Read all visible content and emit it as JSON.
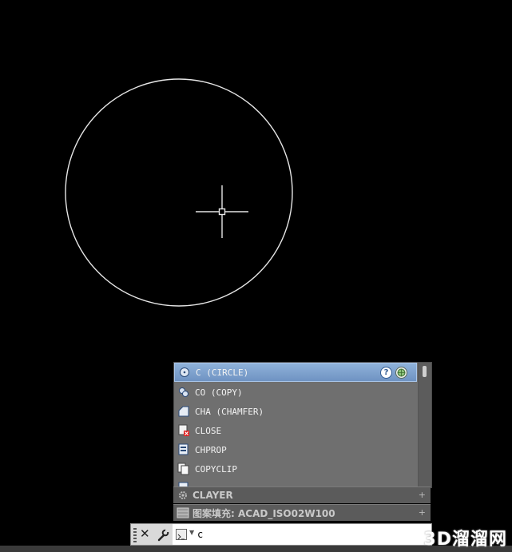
{
  "drawing": {
    "circle_color": "#e6e6e6",
    "crosshair_color": "#e6e6e6"
  },
  "autocomplete": {
    "items": [
      {
        "label": "C (CIRCLE)",
        "icon": "circle-command-icon",
        "selected": true
      },
      {
        "label": "CO (COPY)",
        "icon": "copy-command-icon"
      },
      {
        "label": "CHA (CHAMFER)",
        "icon": "chamfer-command-icon"
      },
      {
        "label": "CLOSE",
        "icon": "close-drawing-icon"
      },
      {
        "label": "CHPROP",
        "icon": "chprop-command-icon"
      },
      {
        "label": "COPYCLIP",
        "icon": "copyclip-command-icon"
      }
    ],
    "help_label": "?",
    "selected_color": "#7aa0d0"
  },
  "history": {
    "items": [
      {
        "label": "CLAYER",
        "icon": "sysvar-gear-icon"
      },
      {
        "label": "图案填充: ACAD_ISO02W100",
        "icon": "hatch-icon"
      }
    ],
    "expand_symbol": "+"
  },
  "command_line": {
    "close_symbol": "✕",
    "value": "c"
  },
  "watermark": {
    "text": "3D溜溜网"
  }
}
